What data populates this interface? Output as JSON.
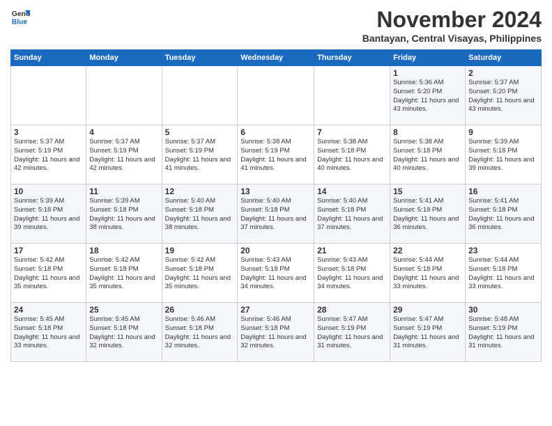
{
  "header": {
    "logo_line1": "General",
    "logo_line2": "Blue",
    "month": "November 2024",
    "location": "Bantayan, Central Visayas, Philippines"
  },
  "weekdays": [
    "Sunday",
    "Monday",
    "Tuesday",
    "Wednesday",
    "Thursday",
    "Friday",
    "Saturday"
  ],
  "weeks": [
    [
      {
        "day": "",
        "info": ""
      },
      {
        "day": "",
        "info": ""
      },
      {
        "day": "",
        "info": ""
      },
      {
        "day": "",
        "info": ""
      },
      {
        "day": "",
        "info": ""
      },
      {
        "day": "1",
        "info": "Sunrise: 5:36 AM\nSunset: 5:20 PM\nDaylight: 11 hours and 43 minutes."
      },
      {
        "day": "2",
        "info": "Sunrise: 5:37 AM\nSunset: 5:20 PM\nDaylight: 11 hours and 43 minutes."
      }
    ],
    [
      {
        "day": "3",
        "info": "Sunrise: 5:37 AM\nSunset: 5:19 PM\nDaylight: 11 hours and 42 minutes."
      },
      {
        "day": "4",
        "info": "Sunrise: 5:37 AM\nSunset: 5:19 PM\nDaylight: 11 hours and 42 minutes."
      },
      {
        "day": "5",
        "info": "Sunrise: 5:37 AM\nSunset: 5:19 PM\nDaylight: 11 hours and 41 minutes."
      },
      {
        "day": "6",
        "info": "Sunrise: 5:38 AM\nSunset: 5:19 PM\nDaylight: 11 hours and 41 minutes."
      },
      {
        "day": "7",
        "info": "Sunrise: 5:38 AM\nSunset: 5:18 PM\nDaylight: 11 hours and 40 minutes."
      },
      {
        "day": "8",
        "info": "Sunrise: 5:38 AM\nSunset: 5:18 PM\nDaylight: 11 hours and 40 minutes."
      },
      {
        "day": "9",
        "info": "Sunrise: 5:39 AM\nSunset: 5:18 PM\nDaylight: 11 hours and 39 minutes."
      }
    ],
    [
      {
        "day": "10",
        "info": "Sunrise: 5:39 AM\nSunset: 5:18 PM\nDaylight: 11 hours and 39 minutes."
      },
      {
        "day": "11",
        "info": "Sunrise: 5:39 AM\nSunset: 5:18 PM\nDaylight: 11 hours and 38 minutes."
      },
      {
        "day": "12",
        "info": "Sunrise: 5:40 AM\nSunset: 5:18 PM\nDaylight: 11 hours and 38 minutes."
      },
      {
        "day": "13",
        "info": "Sunrise: 5:40 AM\nSunset: 5:18 PM\nDaylight: 11 hours and 37 minutes."
      },
      {
        "day": "14",
        "info": "Sunrise: 5:40 AM\nSunset: 5:18 PM\nDaylight: 11 hours and 37 minutes."
      },
      {
        "day": "15",
        "info": "Sunrise: 5:41 AM\nSunset: 5:18 PM\nDaylight: 11 hours and 36 minutes."
      },
      {
        "day": "16",
        "info": "Sunrise: 5:41 AM\nSunset: 5:18 PM\nDaylight: 11 hours and 36 minutes."
      }
    ],
    [
      {
        "day": "17",
        "info": "Sunrise: 5:42 AM\nSunset: 5:18 PM\nDaylight: 11 hours and 35 minutes."
      },
      {
        "day": "18",
        "info": "Sunrise: 5:42 AM\nSunset: 5:18 PM\nDaylight: 11 hours and 35 minutes."
      },
      {
        "day": "19",
        "info": "Sunrise: 5:42 AM\nSunset: 5:18 PM\nDaylight: 11 hours and 35 minutes."
      },
      {
        "day": "20",
        "info": "Sunrise: 5:43 AM\nSunset: 5:18 PM\nDaylight: 11 hours and 34 minutes."
      },
      {
        "day": "21",
        "info": "Sunrise: 5:43 AM\nSunset: 5:18 PM\nDaylight: 11 hours and 34 minutes."
      },
      {
        "day": "22",
        "info": "Sunrise: 5:44 AM\nSunset: 5:18 PM\nDaylight: 11 hours and 33 minutes."
      },
      {
        "day": "23",
        "info": "Sunrise: 5:44 AM\nSunset: 5:18 PM\nDaylight: 11 hours and 33 minutes."
      }
    ],
    [
      {
        "day": "24",
        "info": "Sunrise: 5:45 AM\nSunset: 5:18 PM\nDaylight: 11 hours and 33 minutes."
      },
      {
        "day": "25",
        "info": "Sunrise: 5:45 AM\nSunset: 5:18 PM\nDaylight: 11 hours and 32 minutes."
      },
      {
        "day": "26",
        "info": "Sunrise: 5:46 AM\nSunset: 5:18 PM\nDaylight: 11 hours and 32 minutes."
      },
      {
        "day": "27",
        "info": "Sunrise: 5:46 AM\nSunset: 5:18 PM\nDaylight: 11 hours and 32 minutes."
      },
      {
        "day": "28",
        "info": "Sunrise: 5:47 AM\nSunset: 5:19 PM\nDaylight: 11 hours and 31 minutes."
      },
      {
        "day": "29",
        "info": "Sunrise: 5:47 AM\nSunset: 5:19 PM\nDaylight: 11 hours and 31 minutes."
      },
      {
        "day": "30",
        "info": "Sunrise: 5:48 AM\nSunset: 5:19 PM\nDaylight: 11 hours and 31 minutes."
      }
    ]
  ]
}
